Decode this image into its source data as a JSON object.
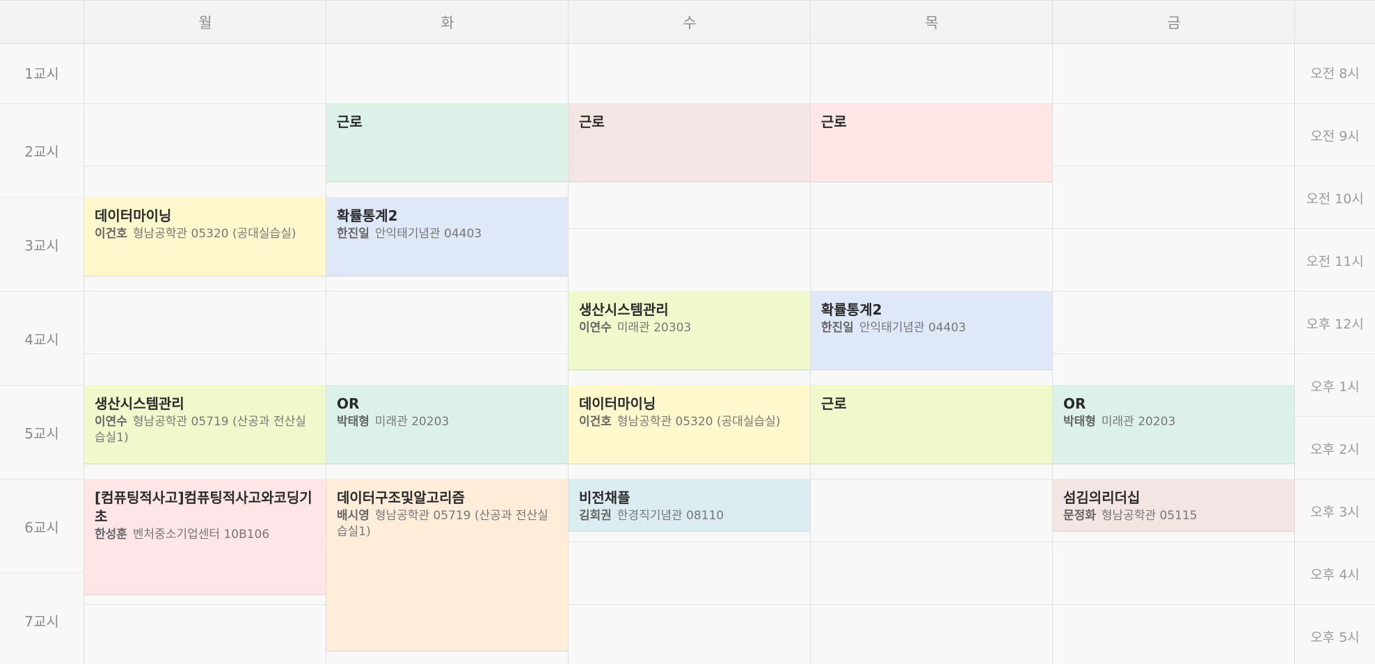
{
  "days": [
    "월",
    "화",
    "수",
    "목",
    "금"
  ],
  "periods": [
    "1교시",
    "2교시",
    "3교시",
    "4교시",
    "5교시",
    "6교시",
    "7교시"
  ],
  "times": [
    "오전 8시",
    "오전 9시",
    "오전 10시",
    "오전 11시",
    "오후 12시",
    "오후 1시",
    "오후 2시",
    "오후 3시",
    "오후 4시",
    "오후 5시"
  ],
  "classes": [
    {
      "name": "데이터마이닝",
      "prof": "이건호",
      "room": "형남공학관 05320 (공대실습실)",
      "color": "#fff8cc"
    },
    {
      "name": "생산시스템관리",
      "prof": "이연수",
      "room": "형남공학관 05719 (산공과 전산실습실1)",
      "color": "#f0f9cc"
    },
    {
      "name": "[컴퓨팅적사고]컴퓨팅적사고와코딩기초",
      "prof": "한성훈",
      "room": "벤처중소기업센터 10B106",
      "color": "#fee5e7"
    },
    {
      "name": "근로",
      "prof": "",
      "room": "",
      "color": "#dcf1e8"
    },
    {
      "name": "확률통계2",
      "prof": "한진일",
      "room": "안익태기념관 04403",
      "color": "#dfe8f7"
    },
    {
      "name": "OR",
      "prof": "박태형",
      "room": "미래관 20203",
      "color": "#dcf1e8"
    },
    {
      "name": "데이터구조및알고리즘",
      "prof": "배시영",
      "room": "형남공학관 05719 (산공과 전산실습실1)",
      "color": "#ffedd9"
    },
    {
      "name": "근로",
      "prof": "",
      "room": "",
      "color": "#f4e5e5"
    },
    {
      "name": "생산시스템관리",
      "prof": "이연수",
      "room": "미래관 20303",
      "color": "#f0f9cc"
    },
    {
      "name": "데이터마이닝",
      "prof": "이건호",
      "room": "형남공학관 05320 (공대실습실)",
      "color": "#fff8cc"
    },
    {
      "name": "비전채플",
      "prof": "김회권",
      "room": "한경직기념관 08110",
      "color": "#dcedf2"
    },
    {
      "name": "근로",
      "prof": "",
      "room": "",
      "color": "#ffe7e8"
    },
    {
      "name": "확률통계2",
      "prof": "한진일",
      "room": "안익태기념관 04403",
      "color": "#dfe8f7"
    },
    {
      "name": "근로",
      "prof": "",
      "room": "",
      "color": "#f0f9cc"
    },
    {
      "name": "OR",
      "prof": "박태형",
      "room": "미래관 20203",
      "color": "#dcf1e8"
    },
    {
      "name": "섬김의리더십",
      "prof": "문정화",
      "room": "형남공학관 05115",
      "color": "#f4e5e5"
    }
  ]
}
